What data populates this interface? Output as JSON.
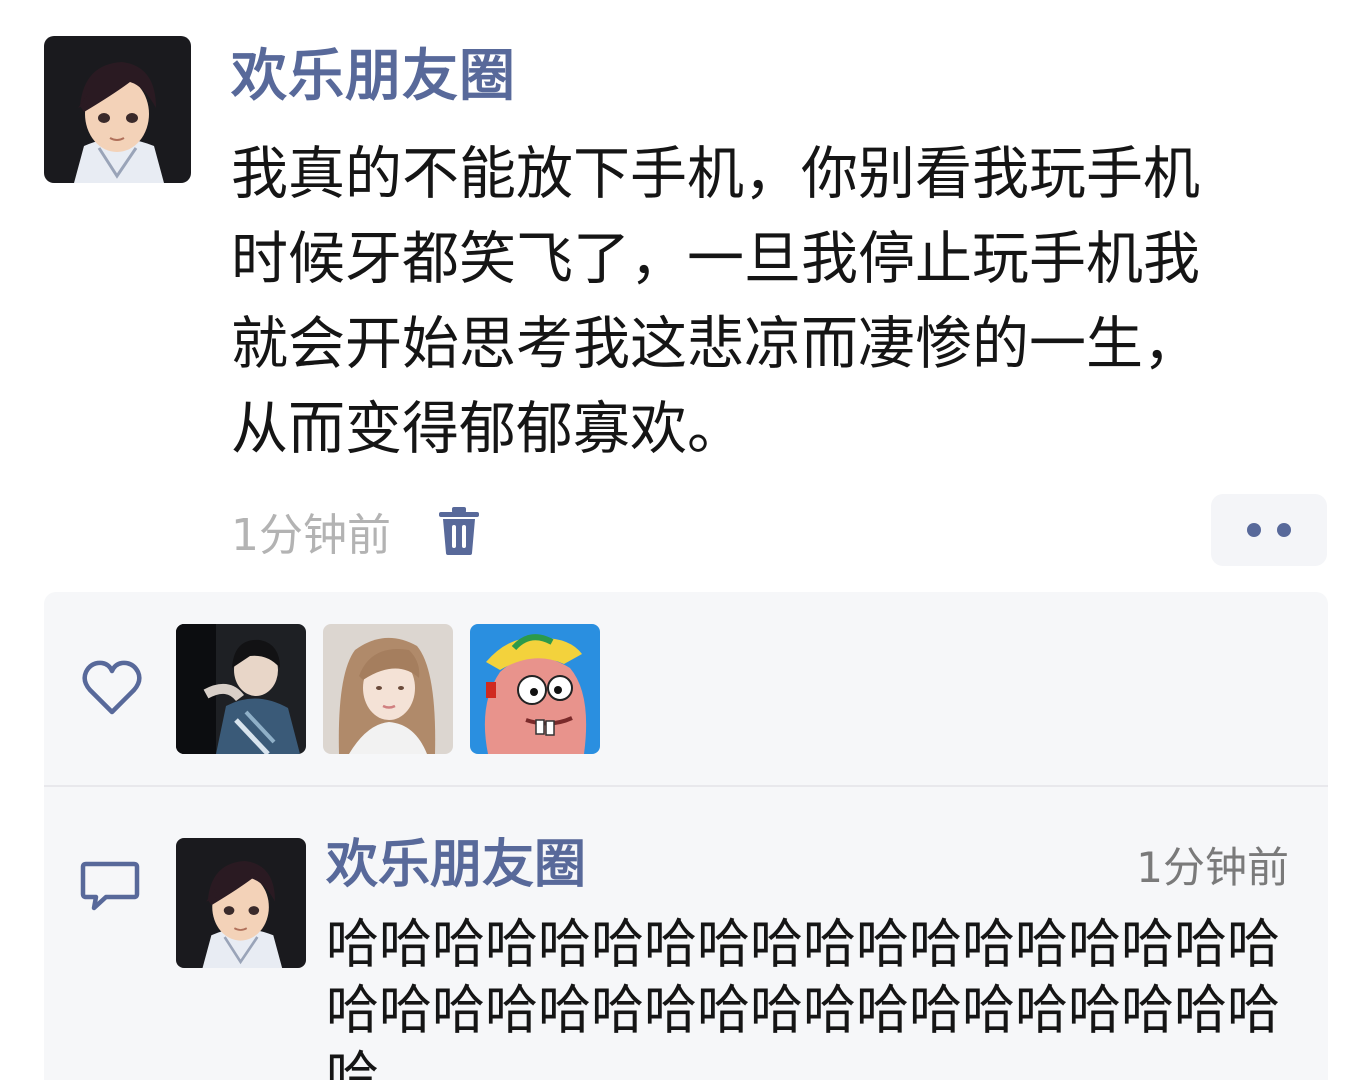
{
  "post": {
    "author": "欢乐朋友圈",
    "text_lines": [
      "我真的不能放下手机，你别看我玩手机",
      "时候牙都笑飞了，一旦我停止玩手机我",
      "就会开始思考我这悲凉而凄惨的一生，",
      "从而变得郁郁寡欢。"
    ],
    "time": "1分钟前",
    "delete_icon": "trash-icon",
    "more_icon": "more-dots-icon"
  },
  "likes": {
    "icon": "heart-icon",
    "count": 3
  },
  "comment": {
    "icon": "comment-icon",
    "author": "欢乐朋友圈",
    "time": "1分钟前",
    "text": "哈哈哈哈哈哈哈哈哈哈哈哈哈哈哈哈哈哈哈哈哈哈哈哈哈哈哈哈哈哈哈哈哈哈哈哈哈"
  },
  "colors": {
    "name": "#58699a",
    "text": "#151515",
    "time": "#b3b3b3",
    "panel": "#f6f7f9"
  }
}
